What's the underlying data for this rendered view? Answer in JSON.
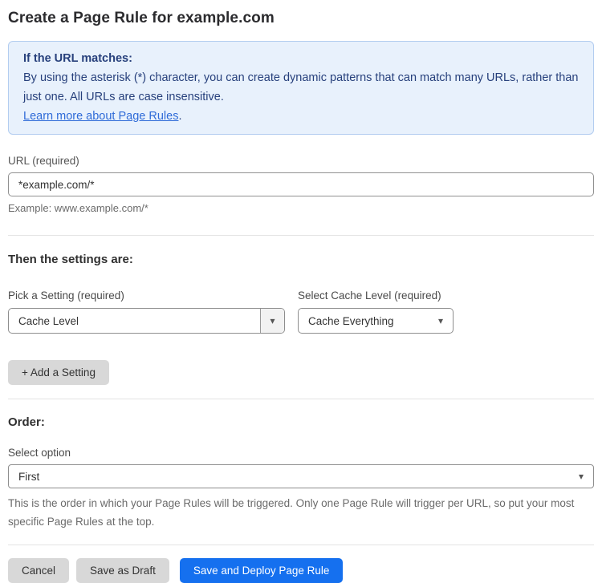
{
  "page": {
    "title": "Create a Page Rule for example.com"
  },
  "info_box": {
    "heading": "If the URL matches:",
    "body": "By using the asterisk (*) character, you can create dynamic patterns that can match many URLs, rather than just one. All URLs are case insensitive.",
    "link_text": "Learn more about Page Rules",
    "link_suffix": "."
  },
  "url_field": {
    "label": "URL (required)",
    "value": "*example.com/*",
    "helper": "Example: www.example.com/*"
  },
  "settings_section": {
    "heading": "Then the settings are:",
    "setting_select": {
      "label": "Pick a Setting (required)",
      "value": "Cache Level"
    },
    "cache_level_select": {
      "label": "Select Cache Level (required)",
      "value": "Cache Everything"
    },
    "add_setting_label": "+ Add a Setting"
  },
  "order_section": {
    "heading": "Order:",
    "select_label": "Select option",
    "select_value": "First",
    "helper": "This is the order in which your Page Rules will be triggered. Only one Page Rule will trigger per URL, so put your most specific Page Rules at the top."
  },
  "actions": {
    "cancel": "Cancel",
    "save_draft": "Save as Draft",
    "save_deploy": "Save and Deploy Page Rule"
  },
  "icons": {
    "dropdown_arrow": "▾"
  },
  "colors": {
    "info_bg": "#e8f1fc",
    "info_border": "#b3cdf0",
    "info_text": "#27407c",
    "link": "#2f6bd8",
    "primary_button": "#1570ef",
    "secondary_button": "#d8d8d8"
  }
}
